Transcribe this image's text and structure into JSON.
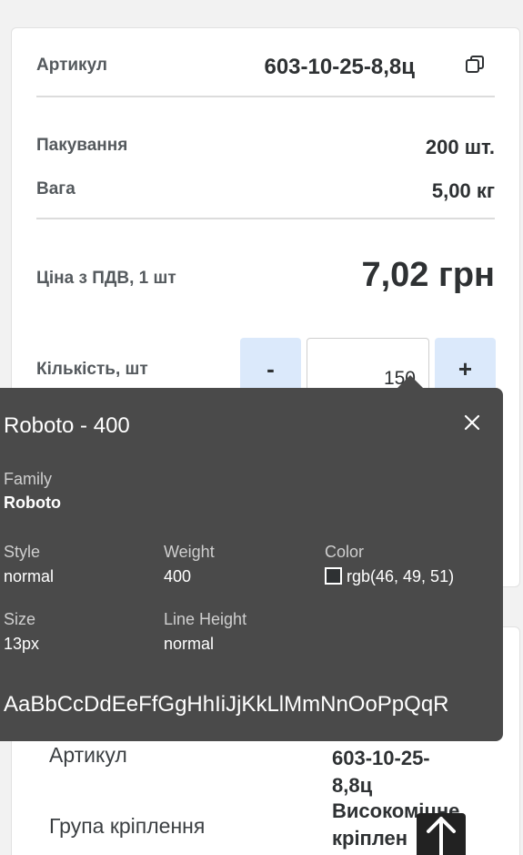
{
  "product": {
    "sku_label": "Артикул",
    "sku_value": "603-10-25-8,8ц",
    "packaging_label": "Пакування",
    "packaging_value": "200 шт.",
    "weight_label": "Вага",
    "weight_value": "5,00 кг",
    "price_label": "Ціна з ПДВ, 1 шт",
    "price_value": "7,02 грн",
    "qty_label": "Кількість, шт",
    "qty_minus": "-",
    "qty_plus": "+",
    "qty_value": "150"
  },
  "details": {
    "sku_label": "Артикул",
    "sku_value_line1": "603-10-25-",
    "sku_value_line2": "8,8ц",
    "group_label": "Група кріплення",
    "group_value_line1": "Високоміцне",
    "group_value_line2": "кріплен"
  },
  "font_inspector": {
    "title": "Roboto - 400",
    "family_label": "Family",
    "family_value": "Roboto",
    "style_label": "Style",
    "style_value": "normal",
    "weight_label": "Weight",
    "weight_value": "400",
    "color_label": "Color",
    "color_value": "rgb(46, 49, 51)",
    "size_label": "Size",
    "size_value": "13px",
    "line_height_label": "Line Height",
    "line_height_value": "normal",
    "sample": "AaBbCcDdEeFfGgHhIiJjKkLlMmNnOoPpQqR"
  },
  "colors": {
    "text": "#2e3133",
    "qty_button_bg": "#dbe9fb",
    "tooltip_bg": "#4a4a4a"
  }
}
